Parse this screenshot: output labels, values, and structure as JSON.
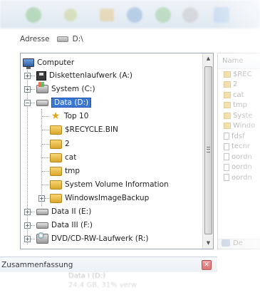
{
  "address": {
    "label": "Adresse",
    "value": "D:\\"
  },
  "tree": {
    "computer": "Computer",
    "floppy": "Diskettenlaufwerk (A:)",
    "system": "System (C:)",
    "data": "Data  (D:)",
    "folders": [
      "Top 10",
      "$RECYCLE.BIN",
      "2",
      "cat",
      "tmp",
      "System Volume Information",
      "WindowsImageBackup"
    ],
    "data2": "Data II (E:)",
    "data3": "Data III (F:)",
    "dvd": "DVD/CD-RW-Laufwerk (R:)"
  },
  "files": {
    "header": "Name",
    "rows": [
      {
        "icon": "folder-icon",
        "name": "$REC"
      },
      {
        "icon": "folder-icon",
        "name": "2"
      },
      {
        "icon": "folder-icon",
        "name": "cat"
      },
      {
        "icon": "folder-icon",
        "name": "tmp"
      },
      {
        "icon": "folder-icon",
        "name": "Syste"
      },
      {
        "icon": "folder-icon",
        "name": "Windo"
      },
      {
        "icon": "document-icon",
        "name": "fdsf"
      },
      {
        "icon": "document-icon",
        "name": "tecnr"
      },
      {
        "icon": "document-icon",
        "name": "oordn"
      },
      {
        "icon": "document-icon",
        "name": "oordn"
      },
      {
        "icon": "document-icon",
        "name": "oordn"
      }
    ],
    "footer": "De"
  },
  "summary": {
    "title": "Zusammenfassung",
    "close": "✕",
    "lines": [
      "Data I (D:)",
      "24,4 GB, 31% verw"
    ]
  },
  "colors": {
    "selection": "#3a78d6",
    "tree_border": "#9aa7b8",
    "folder": "#e7bf52"
  }
}
